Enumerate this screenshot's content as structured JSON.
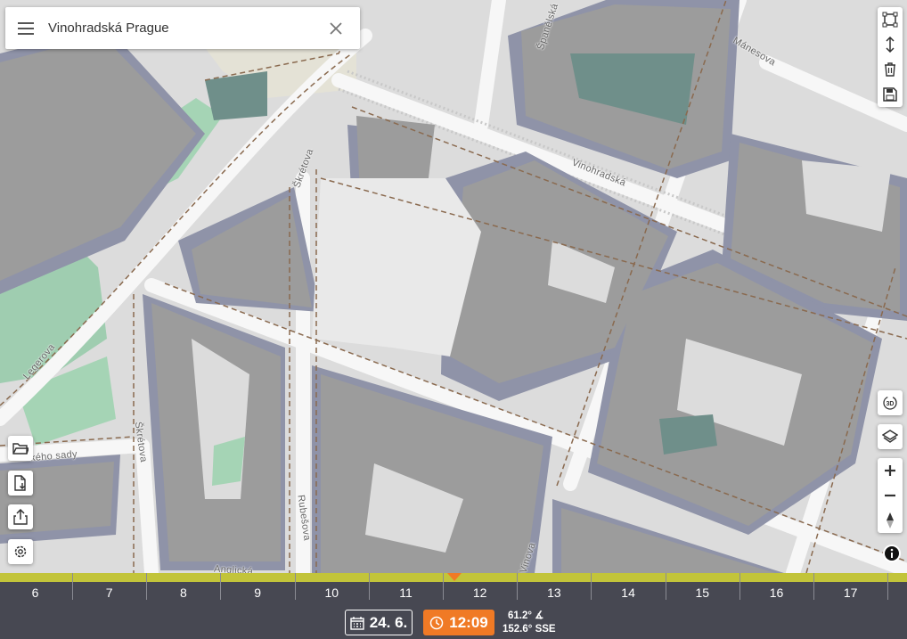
{
  "search": {
    "query": "Vinohradská Prague"
  },
  "streets": {
    "vinohradska": "Vinohradská",
    "manesova": "Mánesova",
    "spanelska": "Španělská",
    "sverova": "Škrétova",
    "skretova": "Škrétova",
    "rubesova": "Rubešova",
    "legerova": "Legerova",
    "sady": "kého sady",
    "anglicka": "Anglická",
    "vinova": "Vinova"
  },
  "tools": {
    "polygon": "polygon-draw-icon",
    "height": "vertical-measure-icon",
    "delete": "trash-icon",
    "save": "save-icon",
    "view3d": "rotate-3d-icon",
    "layers": "layers-icon",
    "zoom_in": "plus-icon",
    "zoom_out": "minus-icon",
    "compass": "compass-icon",
    "info": "info-icon",
    "open": "folder-icon",
    "export": "file-download-icon",
    "share": "share-icon",
    "settings": "gear-icon"
  },
  "timeline": {
    "hours": [
      "6",
      "7",
      "8",
      "9",
      "10",
      "11",
      "12",
      "13",
      "14",
      "15",
      "16",
      "17"
    ]
  },
  "date": {
    "label": "24. 6."
  },
  "time": {
    "label": "12:09"
  },
  "sun": {
    "elevation": "61.2° ∡",
    "azimuth": "152.6° SSE"
  },
  "colors": {
    "accent": "#f07a25",
    "timeline": "#c2c43a",
    "panel": "#474852"
  }
}
